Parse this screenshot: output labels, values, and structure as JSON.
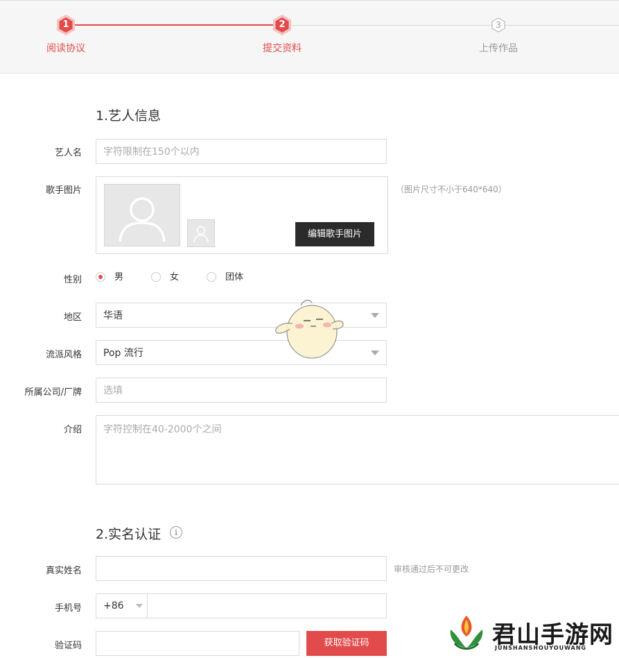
{
  "stepper": {
    "steps": [
      {
        "num": "1",
        "label": "阅读协议"
      },
      {
        "num": "2",
        "label": "提交资料"
      },
      {
        "num": "3",
        "label": "上传作品"
      }
    ]
  },
  "colors": {
    "accent": "#e24b4b",
    "dark_button": "#2b2b2b"
  },
  "artist_section": {
    "title": "1.艺人信息",
    "artist_name": {
      "label": "艺人名",
      "placeholder": "字符限制在150个以内"
    },
    "singer_photo": {
      "label": "歌手图片",
      "hint": "（图片尺寸不小于640*640）",
      "edit_button": "编辑歌手图片"
    },
    "gender": {
      "label": "性别",
      "options": [
        "男",
        "女",
        "团体"
      ],
      "selected": "男"
    },
    "region": {
      "label": "地区",
      "value": "华语"
    },
    "genre": {
      "label": "流派风格",
      "value": "Pop 流行"
    },
    "company": {
      "label": "所属公司/厂牌",
      "placeholder": "选填"
    },
    "intro": {
      "label": "介绍",
      "placeholder": "字符控制在40-2000个之间"
    }
  },
  "verify_section": {
    "title": "2.实名认证",
    "info_icon": "info-icon",
    "real_name": {
      "label": "真实姓名",
      "hint": "审核通过后不可更改"
    },
    "phone": {
      "label": "手机号",
      "prefix": "+86"
    },
    "code": {
      "label": "验证码",
      "button": "获取验证码"
    }
  },
  "watermark": {
    "title": "君山手游网",
    "subtitle": "JUNSHANSHOUYOUWANG"
  }
}
